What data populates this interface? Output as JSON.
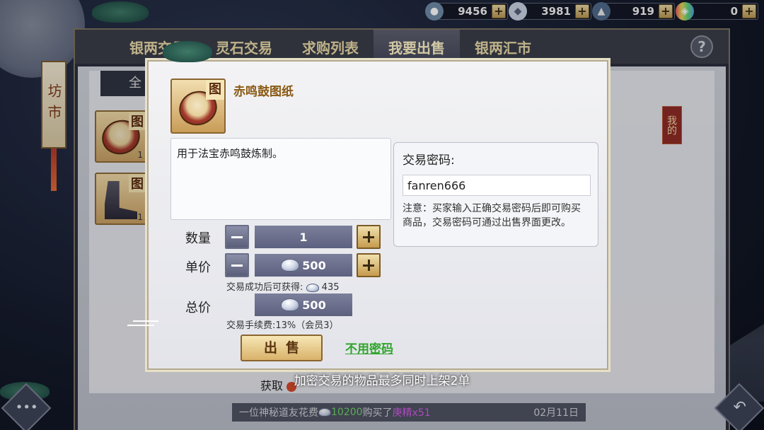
{
  "currency": [
    {
      "icon": "silver-bag-icon",
      "value": "9456"
    },
    {
      "icon": "silver-ingot-icon",
      "value": "3981"
    },
    {
      "icon": "spirit-stone-icon",
      "value": "919"
    },
    {
      "icon": "rainbow-gem-icon",
      "value": "0"
    }
  ],
  "market": {
    "tabs": [
      "银两交易",
      "灵石交易",
      "求购列表",
      "我要出售",
      "银两汇市"
    ],
    "active_tab": 3,
    "help_label": "?",
    "filter_tab_label": "全",
    "side_title": "坊市",
    "my_badge": "我的",
    "bag_slots": [
      {
        "tag": "图",
        "qty": "1"
      },
      {
        "tag": "图",
        "qty": "1"
      }
    ]
  },
  "dialog": {
    "item_tag": "图",
    "item_name": "赤鸣鼓图纸",
    "description": "用于法宝赤鸣鼓炼制。",
    "quantity_label": "数量",
    "quantity_value": "1",
    "unit_price_label": "单价",
    "unit_price_value": "500",
    "after_sale_label": "交易成功后可获得:",
    "after_sale_value": "435",
    "total_label": "总价",
    "total_value": "500",
    "fee_text": "交易手续费:13%（会员3）",
    "sell_button": "出售",
    "no_password_link": "不用密码",
    "password_title": "交易密码:",
    "password_value": "fanren666",
    "password_note": "注意：买家输入正确交易密码后即可购买商品，交易密码可通过出售界面更改。"
  },
  "under_text": "获取",
  "toast": "加密交易的物品最多同时上架2单",
  "ticker": {
    "prefix": "一位神秘道友花费",
    "amount": "10200",
    "middle": "购买了",
    "item": "庚精x51",
    "date": "02月11日"
  },
  "colors": {
    "gold_text": "#8a5a14",
    "link_green": "#2fa52b",
    "tab_text": "#e9d9a8"
  }
}
